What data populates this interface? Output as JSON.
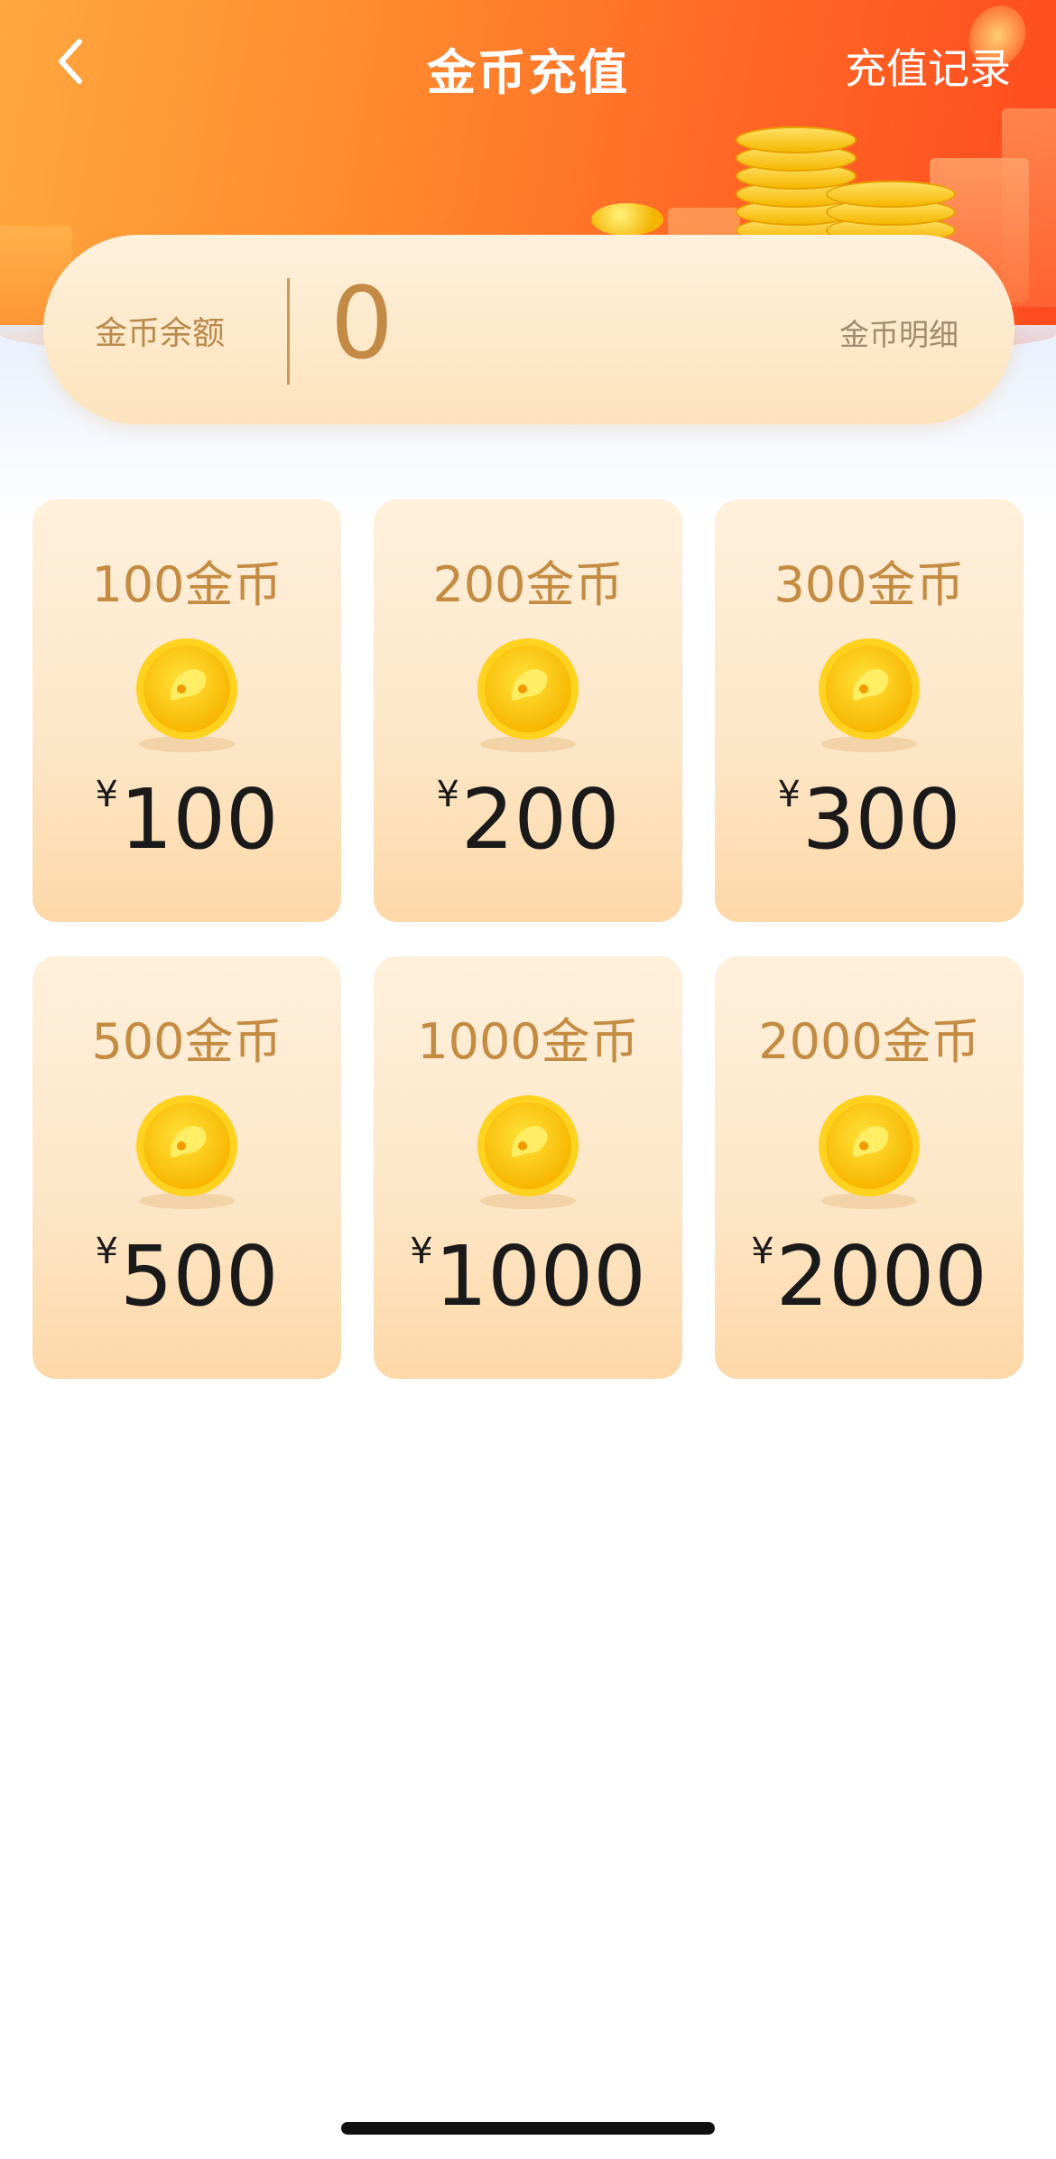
{
  "header": {
    "title": "金币充值",
    "record_link": "充值记录"
  },
  "balance": {
    "label": "金币余额",
    "value": "0",
    "detail_link": "金币明细"
  },
  "packages": [
    {
      "coins_label": "100金币",
      "currency": "¥",
      "price": "100"
    },
    {
      "coins_label": "200金币",
      "currency": "¥",
      "price": "200"
    },
    {
      "coins_label": "300金币",
      "currency": "¥",
      "price": "300"
    },
    {
      "coins_label": "500金币",
      "currency": "¥",
      "price": "500"
    },
    {
      "coins_label": "1000金币",
      "currency": "¥",
      "price": "1000"
    },
    {
      "coins_label": "2000金币",
      "currency": "¥",
      "price": "2000"
    }
  ],
  "icons": {
    "back": "chevron-left-icon",
    "coin": "gold-coin-icon"
  },
  "colors": {
    "header_start": "#ffa83e",
    "header_end": "#ff4a1e",
    "gold_text": "#c48b42",
    "card_bg": "#fde6c6"
  }
}
